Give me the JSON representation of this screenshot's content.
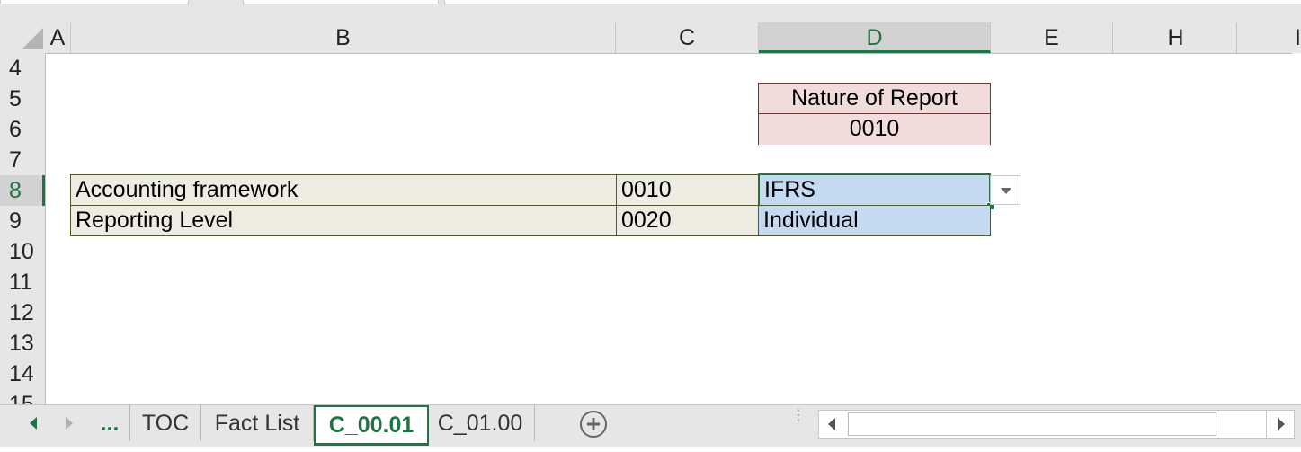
{
  "columns": [
    "A",
    "B",
    "C",
    "D",
    "E",
    "H",
    "I"
  ],
  "selected_column": "D",
  "rows": [
    "4",
    "5",
    "6",
    "7",
    "8",
    "9",
    "10",
    "11",
    "12",
    "13",
    "14",
    "15"
  ],
  "selected_row": "8",
  "cells": {
    "nature_header": "Nature of Report",
    "nature_code": "0010",
    "row8_label": "Accounting framework",
    "row8_code": "0010",
    "row8_value": "IFRS",
    "row9_label": "Reporting Level",
    "row9_code": "0020",
    "row9_value": "Individual"
  },
  "tabs": {
    "ellipsis": "...",
    "items": [
      "TOC",
      "Fact List",
      "C_00.01",
      "C_01.00"
    ],
    "active": "C_00.01"
  },
  "colors": {
    "accent": "#217346",
    "pink_fill": "#f2dcdb",
    "tan_fill": "#eeece1",
    "blue_fill": "#c5d9f1"
  },
  "icons": {
    "prev_sheet": "chevron-left-icon",
    "next_sheet": "chevron-right-icon",
    "add_sheet": "plus-circle-icon",
    "dropdown": "caret-down-icon"
  }
}
